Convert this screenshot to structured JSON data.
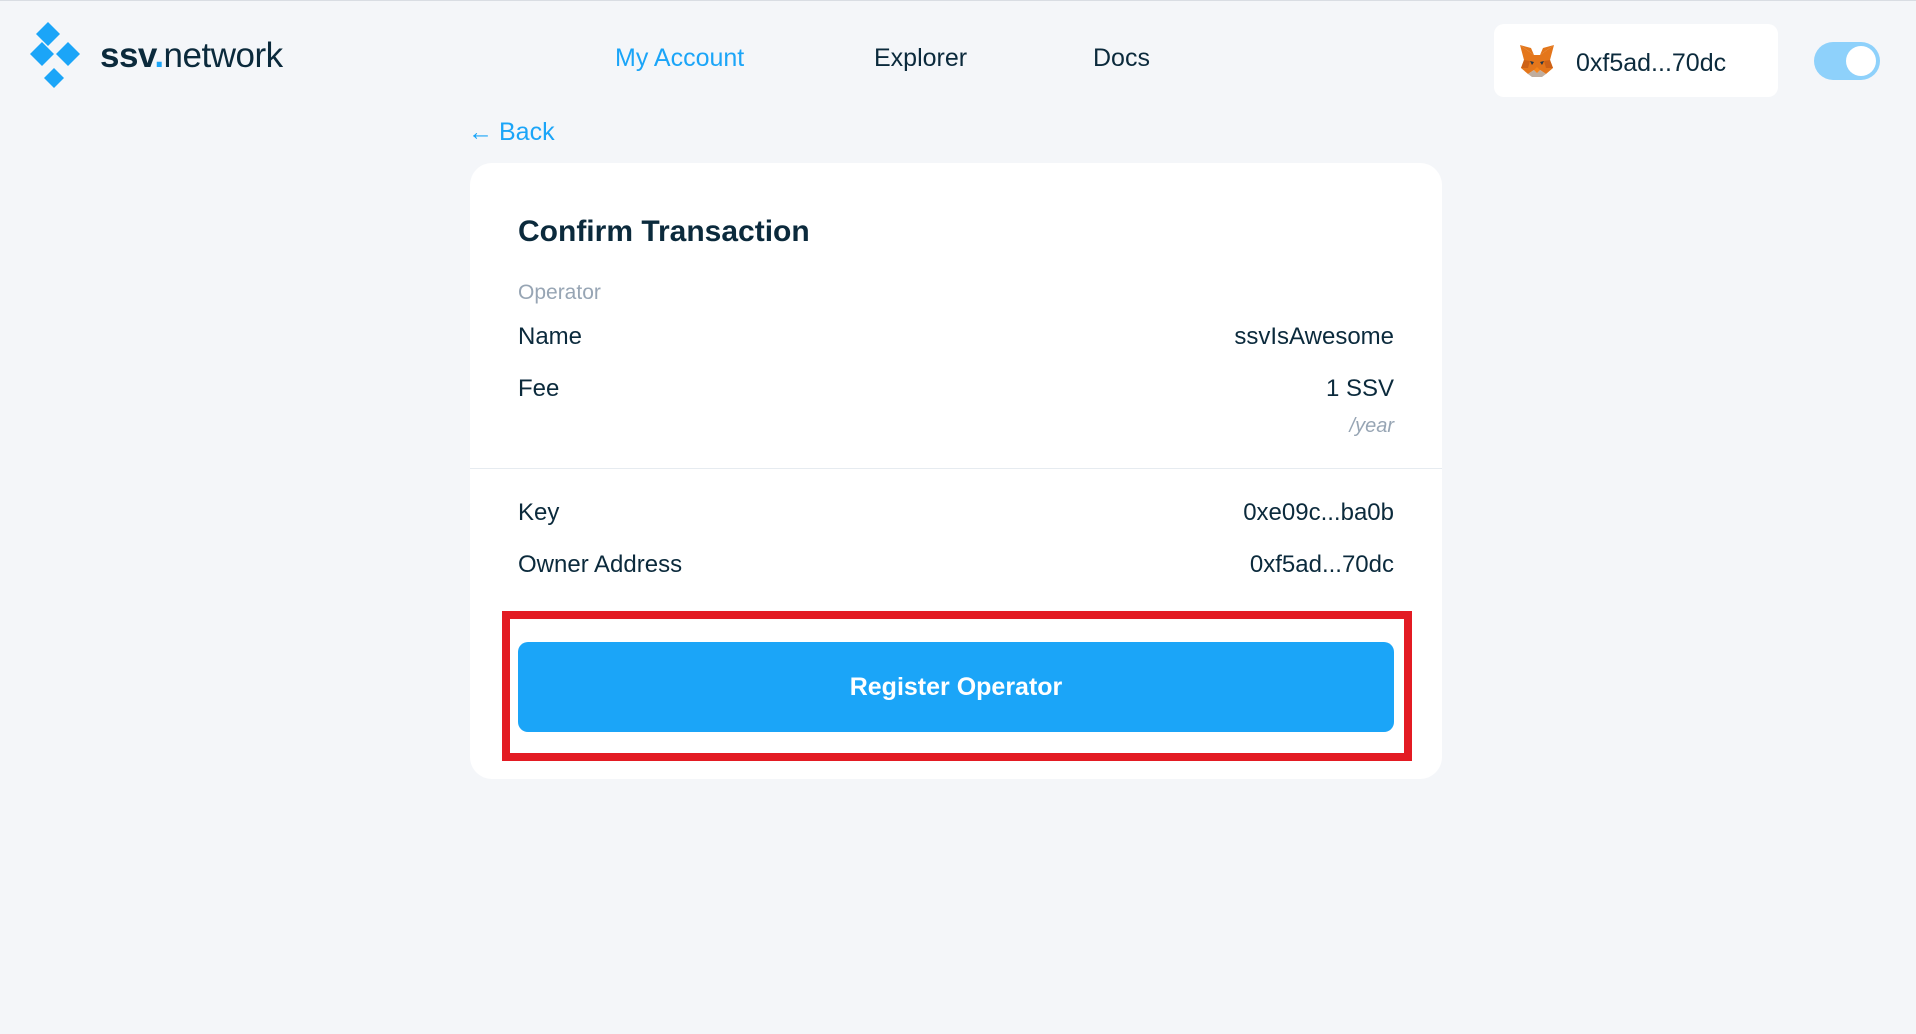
{
  "header": {
    "logo": {
      "text_bold": "ssv",
      "text_dot": ".",
      "text_rest": "network"
    },
    "nav": [
      {
        "label": "My Account",
        "active": true
      },
      {
        "label": "Explorer",
        "active": false
      },
      {
        "label": "Docs",
        "active": false
      }
    ],
    "wallet": {
      "icon": "metamask-fox-icon",
      "address": "0xf5ad...70dc"
    },
    "theme_toggle": {
      "state": "on"
    }
  },
  "back_link": {
    "label": "Back"
  },
  "card": {
    "title": "Confirm Transaction",
    "section_label": "Operator",
    "rows": [
      {
        "label": "Name",
        "value": "ssvIsAwesome"
      },
      {
        "label": "Fee",
        "value": "1 SSV",
        "sub": "/year"
      },
      {
        "label": "Key",
        "value": "0xe09c...ba0b"
      },
      {
        "label": "Owner Address",
        "value": "0xf5ad...70dc"
      }
    ],
    "primary_button": "Register Operator"
  },
  "colors": {
    "accent": "#1ba5f8",
    "background": "#f4f6f9",
    "text": "#0b2a3c",
    "muted": "#97a5b4",
    "highlight_box": "#e31b23"
  }
}
